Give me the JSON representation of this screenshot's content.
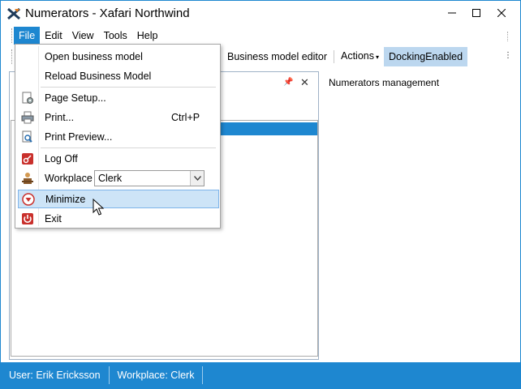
{
  "window": {
    "title": "Numerators - Xafari Northwind",
    "accent_color": "#1e87d0"
  },
  "menubar": {
    "items": [
      {
        "label": "File",
        "active": true
      },
      {
        "label": "Edit"
      },
      {
        "label": "View"
      },
      {
        "label": "Tools"
      },
      {
        "label": "Help"
      }
    ]
  },
  "toolbar": {
    "items": [
      {
        "label": "Business model editor"
      },
      {
        "label": "Actions",
        "has_dropdown": true
      },
      {
        "label": "DockingEnabled",
        "highlighted": true
      }
    ]
  },
  "right_pane": {
    "label": "Numerators management"
  },
  "file_menu": {
    "items": [
      {
        "label": "Open business model",
        "icon": ""
      },
      {
        "label": "Reload Business Model",
        "icon": ""
      },
      {
        "label": "Page Setup...",
        "icon": "page-setup-icon"
      },
      {
        "label": "Print...",
        "icon": "printer-icon",
        "shortcut": "Ctrl+P"
      },
      {
        "label": "Print Preview...",
        "icon": "print-preview-icon"
      },
      {
        "label": "Log Off",
        "icon": "log-off-icon"
      },
      {
        "label": "Workplace",
        "icon": "workplace-icon"
      },
      {
        "label": "Minimize",
        "icon": "minimize-icon",
        "hovered": true
      },
      {
        "label": "Exit",
        "icon": "exit-icon"
      }
    ],
    "workplace_combo": {
      "value": "Clerk"
    }
  },
  "statusbar": {
    "user": "User: Erik Ericksson",
    "workplace": "Workplace: Clerk"
  }
}
